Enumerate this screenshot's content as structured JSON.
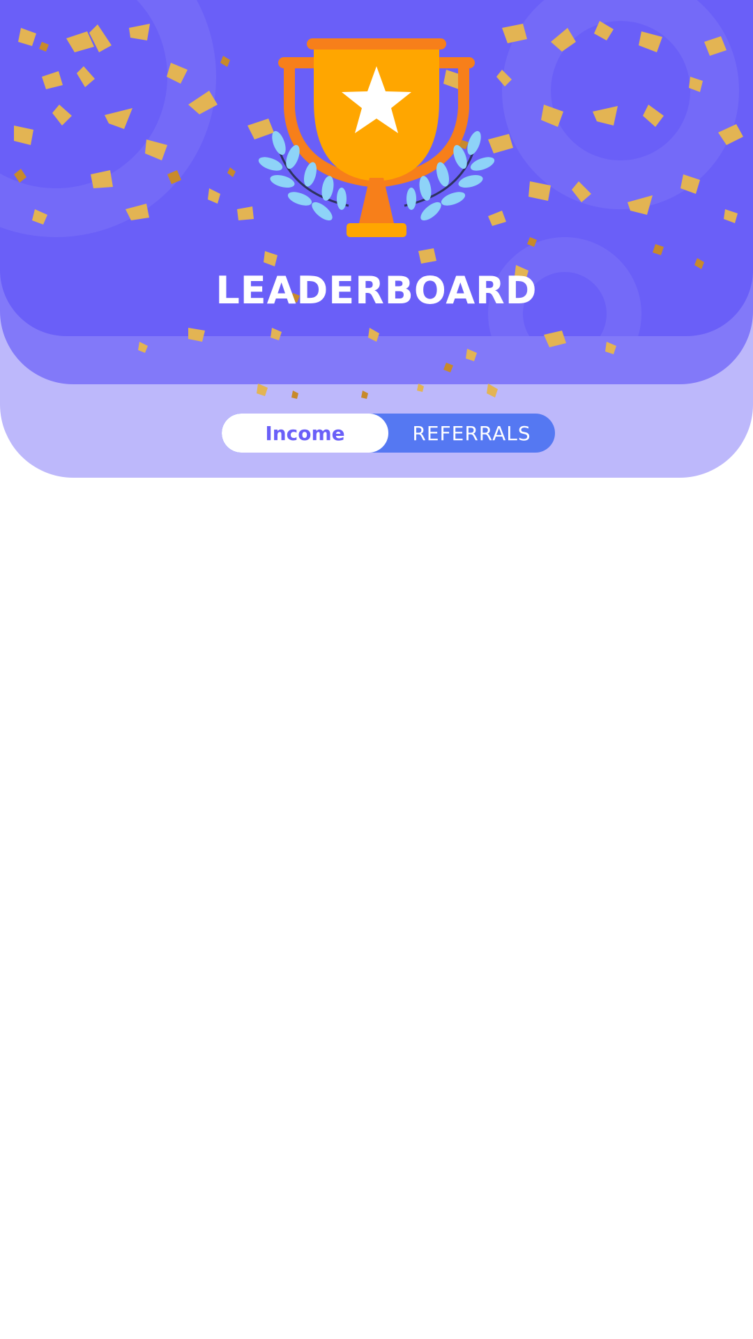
{
  "header": {
    "title": "LEADERBOARD",
    "trophy_icon": "trophy-star-laurel-icon"
  },
  "toggle": {
    "tabs": [
      {
        "label": "Income",
        "active": true
      },
      {
        "label": "REFERRALS",
        "active": false
      }
    ]
  },
  "colors": {
    "primary": "#6a5ff8",
    "secondary": "#8279f9",
    "light": "#bdb8fb",
    "toggle_bg": "#5578f2",
    "trophy": "#ffa600",
    "trophy_handles": "#f77f1a",
    "laurel": "#8ed3f8"
  }
}
